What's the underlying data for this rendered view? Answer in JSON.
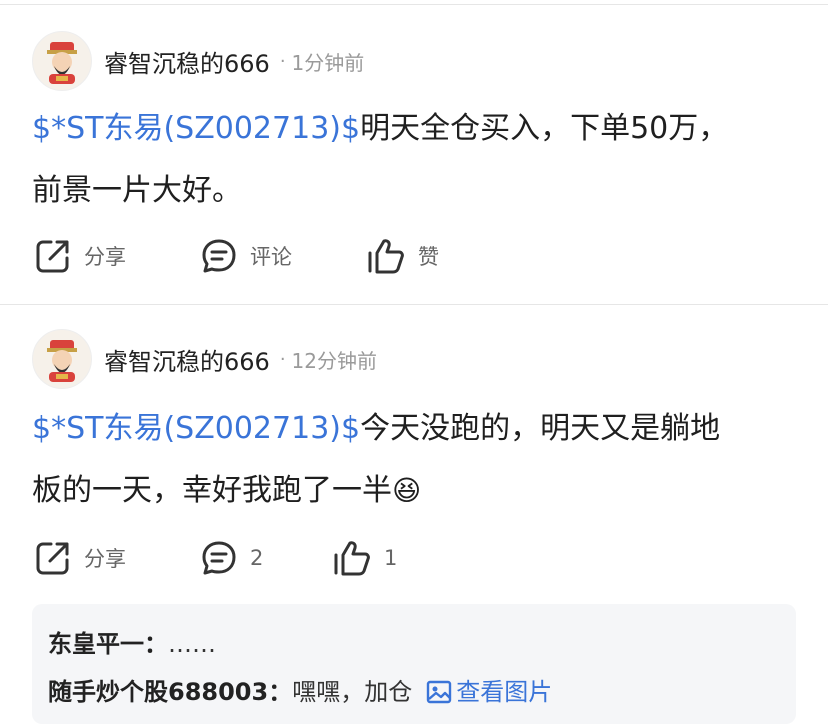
{
  "posts": [
    {
      "author": "睿智沉稳的666",
      "separator": "·",
      "time": "1分钟前",
      "tag": "$*ST东易(SZ002713)$",
      "text_line1": "明天全仓买入，下单50万，",
      "text_line2": "前景一片大好。",
      "share_label": "分享",
      "comment_label": "评论",
      "like_label": "赞"
    },
    {
      "author": "睿智沉稳的666",
      "separator": "·",
      "time": "12分钟前",
      "tag": "$*ST东易(SZ002713)$",
      "text_line1": "今天没跑的，明天又是躺地",
      "text_line2": "板的一天，幸好我跑了一半",
      "emoji": "😆",
      "share_label": "分享",
      "comment_count": "2",
      "like_count": "1"
    }
  ],
  "replies": [
    {
      "author": "东皇平一：",
      "text": "……"
    },
    {
      "author": "随手炒个股688003：",
      "text": "嘿嘿，加仓",
      "link_label": "查看图片"
    }
  ],
  "icons": {
    "share": "share-icon",
    "comment": "comment-icon",
    "like": "thumbs-up-icon",
    "image": "image-icon"
  },
  "colors": {
    "link": "#3a74d8",
    "reply_bg": "#f5f6f8",
    "meta": "#9a9a9a"
  }
}
